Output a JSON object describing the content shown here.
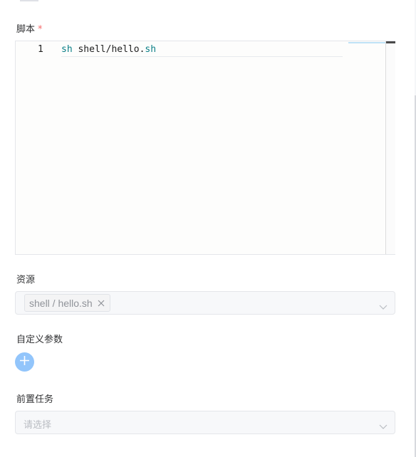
{
  "script_field": {
    "label": "脚本",
    "required_mark": "*",
    "line_number": "1",
    "code": {
      "token1": "sh",
      "token2": " shell/hello.",
      "token3": "sh"
    }
  },
  "resource_field": {
    "label": "资源",
    "selected_tag": "shell / hello.sh"
  },
  "custom_params": {
    "label": "自定义参数"
  },
  "pre_task": {
    "label": "前置任务",
    "placeholder": "请选择"
  },
  "icons": [
    "close-icon",
    "chevron-down-icon",
    "plus-icon"
  ]
}
